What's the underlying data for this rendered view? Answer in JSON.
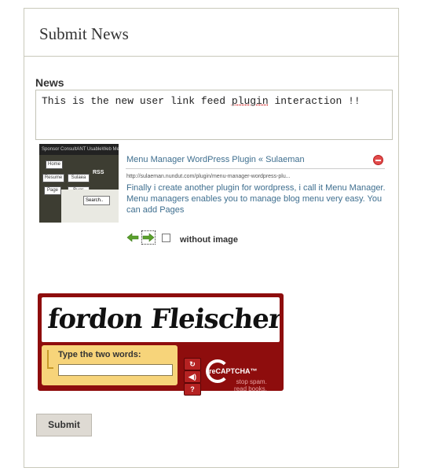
{
  "form": {
    "title": "Submit News",
    "news_label": "News",
    "news_text_prefix": "This is the new user link feed ",
    "news_text_spell": "plugin",
    "news_text_suffix": " interaction !!",
    "submit_label": "Submit"
  },
  "link_preview": {
    "title": "Menu Manager WordPress Plugin « Sulaeman",
    "url": "http://sulaeman.nundut.com/plugin/menu-manager-wordpress-plu...",
    "description": "Finally i create another plugin for wordpress, i call it Menu Manager. Menu managers enables you to manage blog menu very easy. You can add Pages",
    "without_image_label": "without image",
    "thumbnail_bar": "Sponsor  ConsultANT  UsableWeb  Menu",
    "thumbnail_labels": [
      "Home",
      "Resume",
      "Sulaea",
      "Page",
      "Bugs",
      "Search.."
    ],
    "thumbnail_rss": "RSS"
  },
  "captcha": {
    "words": "fordon Fleischer",
    "prompt": "Type the two words:",
    "brand": "reCAPTCHA™",
    "tagline_line1": "stop spam.",
    "tagline_line2": "read books.",
    "reload_glyph": "↻",
    "audio_glyph": "◀)",
    "help_glyph": "?"
  },
  "colors": {
    "link": "#3f6f8f",
    "captcha_bg": "#8e0d0d",
    "captcha_input_bg": "#f7d47a",
    "arrow_green": "#5aa02c"
  }
}
